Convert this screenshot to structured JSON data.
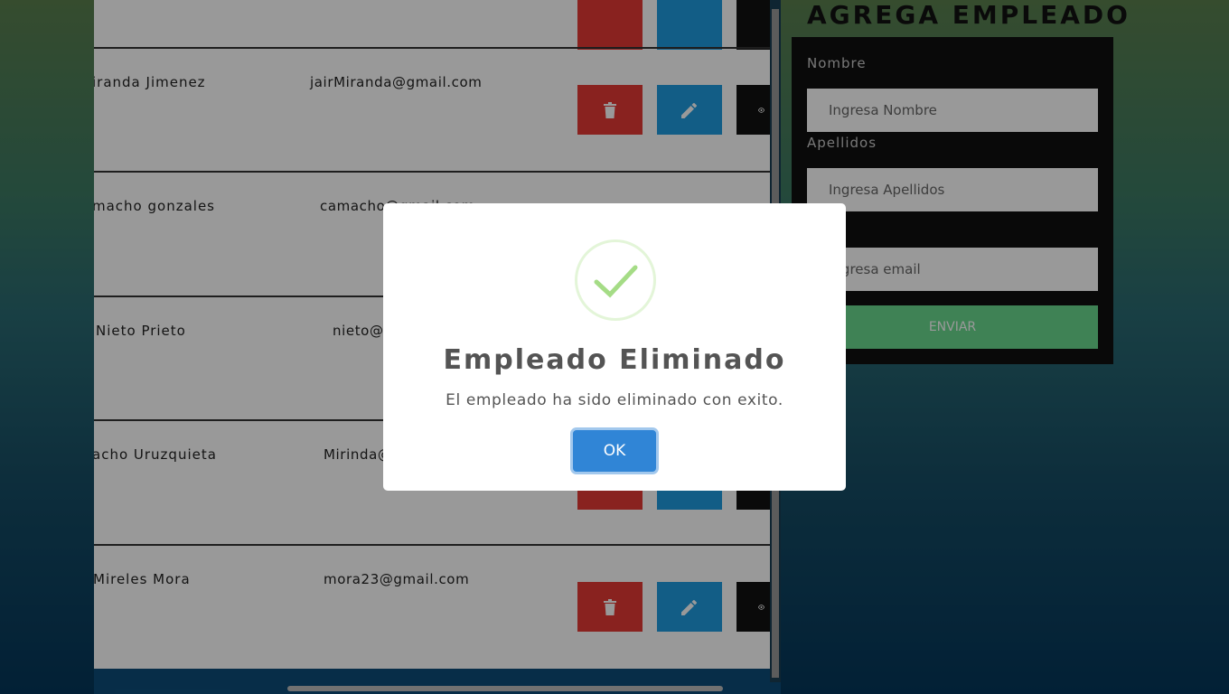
{
  "employees": [
    {
      "name": "",
      "email": ""
    },
    {
      "name": "iranda Jimenez",
      "email": "jairMiranda@gmail.com"
    },
    {
      "name": "macho gonzales",
      "email": "camacho@gmail.com"
    },
    {
      "name": "Nieto Prieto",
      "email": "nieto@"
    },
    {
      "name": "acho Uruzquieta",
      "email": "Mirinda@"
    },
    {
      "name": "Mireles Mora",
      "email": "mora23@gmail.com"
    }
  ],
  "form": {
    "title": "AGREGA EMPLEADO",
    "nombre_label": "Nombre",
    "nombre_placeholder": "Ingresa Nombre",
    "apellidos_label": "Apellidos",
    "apellidos_placeholder": "Ingresa Apellidos",
    "email_placeholder": "Ingresa email",
    "submit_label": "ENVIAR"
  },
  "modal": {
    "title": "Empleado Eliminado",
    "text": "El empleado ha sido eliminado con exito.",
    "ok_label": "OK"
  },
  "icons": {
    "delete": "trash-icon",
    "edit": "pencil-icon",
    "view": "eye-icon",
    "success": "checkmark-icon"
  },
  "colors": {
    "delete": "#e53935",
    "edit": "#1e9be0",
    "view": "#111111",
    "submit": "#6ad98e",
    "ok_button": "#3085d6",
    "success_check": "#a5dc86"
  }
}
